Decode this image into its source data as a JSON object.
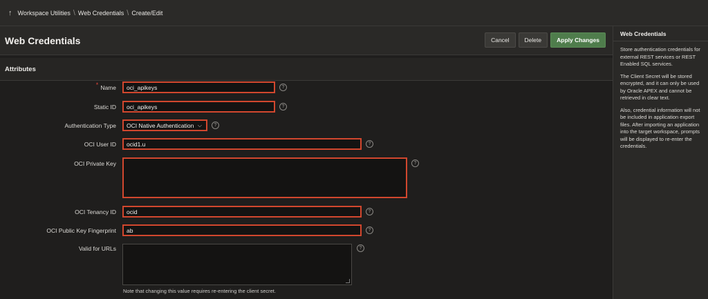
{
  "breadcrumb": {
    "up_icon": "arrow-up-icon",
    "items": [
      "Workspace Utilities",
      "Web Credentials",
      "Create/Edit"
    ]
  },
  "page": {
    "title": "Web Credentials",
    "buttons": {
      "cancel": "Cancel",
      "delete": "Delete",
      "apply": "Apply Changes"
    }
  },
  "region": {
    "title": "Attributes"
  },
  "form": {
    "name": {
      "label": "Name",
      "value": "oci_apikeys",
      "required": true
    },
    "static_id": {
      "label": "Static ID",
      "value": "oci_apikeys"
    },
    "auth_type": {
      "label": "Authentication Type",
      "value": "OCI Native Authentication"
    },
    "oci_user_id": {
      "label": "OCI User ID",
      "value": "ocid1.u"
    },
    "oci_private_key": {
      "label": "OCI Private Key",
      "value": ""
    },
    "oci_tenancy_id": {
      "label": "OCI Tenancy ID",
      "value": "ocid"
    },
    "oci_fingerprint": {
      "label": "OCI Public Key Fingerprint",
      "value": "ab"
    },
    "valid_urls": {
      "label": "Valid for URLs",
      "value": "",
      "note": "Note that changing this value requires re-entering the client secret."
    },
    "help_icon": "question-circle-icon"
  },
  "side_panel": {
    "title": "Web Credentials",
    "paragraphs": [
      "Store authentication credentials for external REST services or REST Enabled SQL services.",
      "The Client Secret will be stored encrypted, and it can only be used by Oracle APEX and cannot be retrieved in clear text.",
      "Also, credential information will not be included in application export files. After importing an application into the target workspace, prompts will be displayed to re-enter the credentials."
    ]
  },
  "colors": {
    "accent_error_border": "#d2472e",
    "primary_button": "#4f7d4c",
    "background": "#1f1e1d"
  }
}
